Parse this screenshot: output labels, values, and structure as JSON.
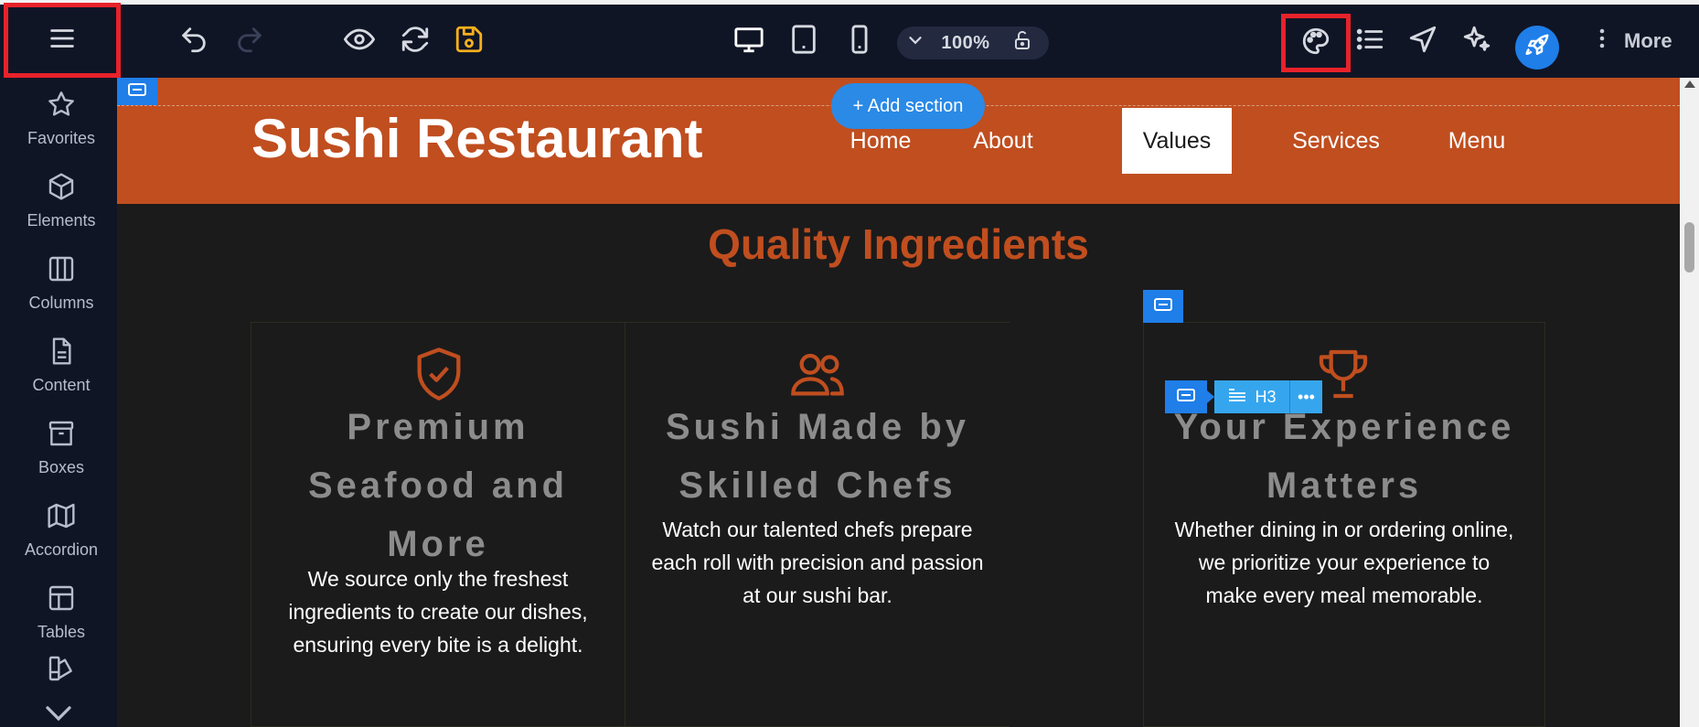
{
  "toolbar": {
    "zoom": "100%",
    "more_label": "More"
  },
  "sidebar": {
    "items": [
      {
        "label": "Favorites",
        "icon": "star-icon"
      },
      {
        "label": "Elements",
        "icon": "cube-icon"
      },
      {
        "label": "Columns",
        "icon": "columns-icon"
      },
      {
        "label": "Content",
        "icon": "document-icon"
      },
      {
        "label": "Boxes",
        "icon": "archive-box-icon"
      },
      {
        "label": "Accordion",
        "icon": "map-icon"
      },
      {
        "label": "Tables",
        "icon": "table-icon"
      }
    ]
  },
  "site": {
    "title": "Sushi Restaurant",
    "nav": [
      "Home",
      "About",
      "Values",
      "Services",
      "Menu"
    ],
    "active_nav": "Values",
    "add_section_label": "+ Add section",
    "section_title": "Quality Ingredients",
    "cards": [
      {
        "icon": "shield-check-icon",
        "heading_lines": [
          "Premium",
          "Seafood and",
          "More"
        ],
        "body_lines": [
          "We source only the freshest",
          "ingredients to create our dishes,",
          "ensuring every bite is a delight."
        ]
      },
      {
        "icon": "users-icon",
        "heading_lines": [
          "Sushi Made by",
          "Skilled Chefs"
        ],
        "body_lines": [
          "Watch our talented chefs prepare",
          "each roll with precision and passion",
          "at our sushi bar."
        ]
      },
      {
        "icon": "trophy-icon",
        "heading_lines": [
          "Your Experience",
          "Matters"
        ],
        "body_lines": [
          "Whether dining in or ordering online,",
          "we prioritize your experience to",
          "make every meal memorable."
        ]
      }
    ],
    "h3_label": "H3"
  },
  "colors": {
    "toolbar_bg": "#101526",
    "header_bg": "#c04e1f",
    "accent_blue": "#1f7ee8",
    "highlight_red": "#e8222a",
    "save_yellow": "#f6b01e"
  }
}
